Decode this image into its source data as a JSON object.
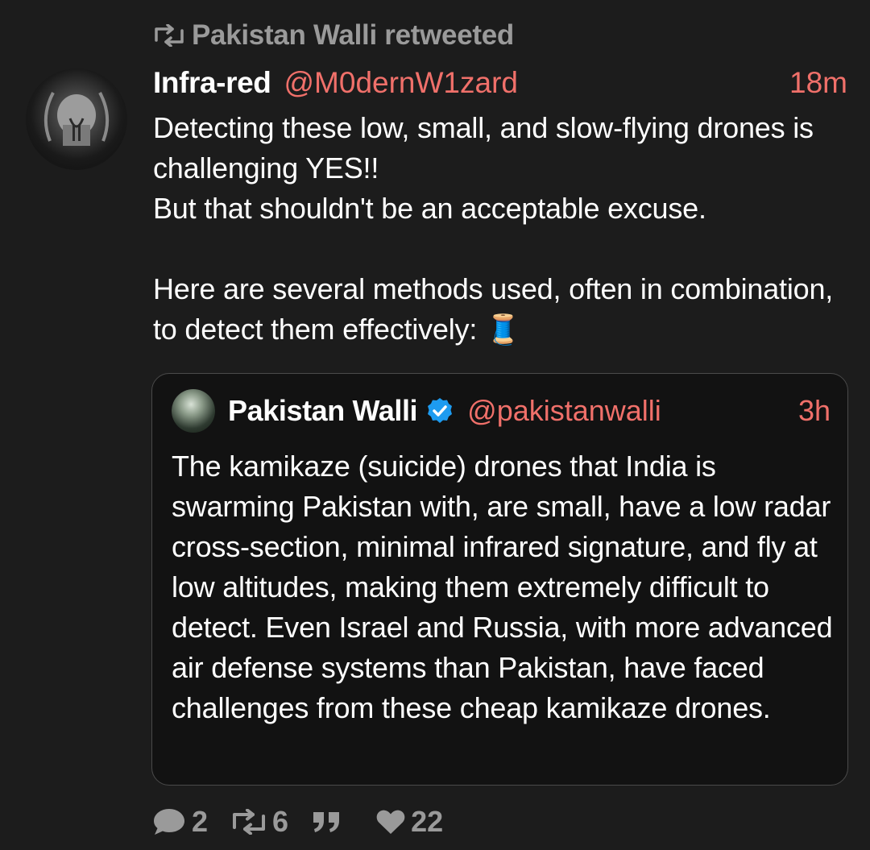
{
  "retweet": {
    "icon": "retweet-icon",
    "text": "Pakistan Walli retweeted"
  },
  "tweet": {
    "display_name": "Infra-red",
    "handle": "@M0dernW1zard",
    "time": "18m",
    "lines": [
      "Detecting these low, small, and slow-flying drones is challenging YES!!",
      "But that shouldn't be an acceptable excuse.",
      "Here are several methods used, often in combination, to detect them effectively: 🧵"
    ]
  },
  "quoted": {
    "display_name": "Pakistan Walli",
    "handle": "@pakistanwalli",
    "time": "3h",
    "text": "The kamikaze (suicide) drones that India is swarming Pakistan with, are small, have a low radar cross-section, minimal infrared signature, and fly at low altitudes, making them extremely difficult to detect. Even Israel and Russia, with more advanced air defense systems than Pakistan, have faced challenges from these cheap kamikaze drones.",
    "verified_icon": "verified-badge-icon"
  },
  "actions": {
    "replies": "2",
    "retweets": "6",
    "likes": "22"
  },
  "colors": {
    "background": "#1c1c1c",
    "accent": "#f0706a",
    "muted": "#9a9a9a",
    "verified": "#1d9bf0"
  }
}
